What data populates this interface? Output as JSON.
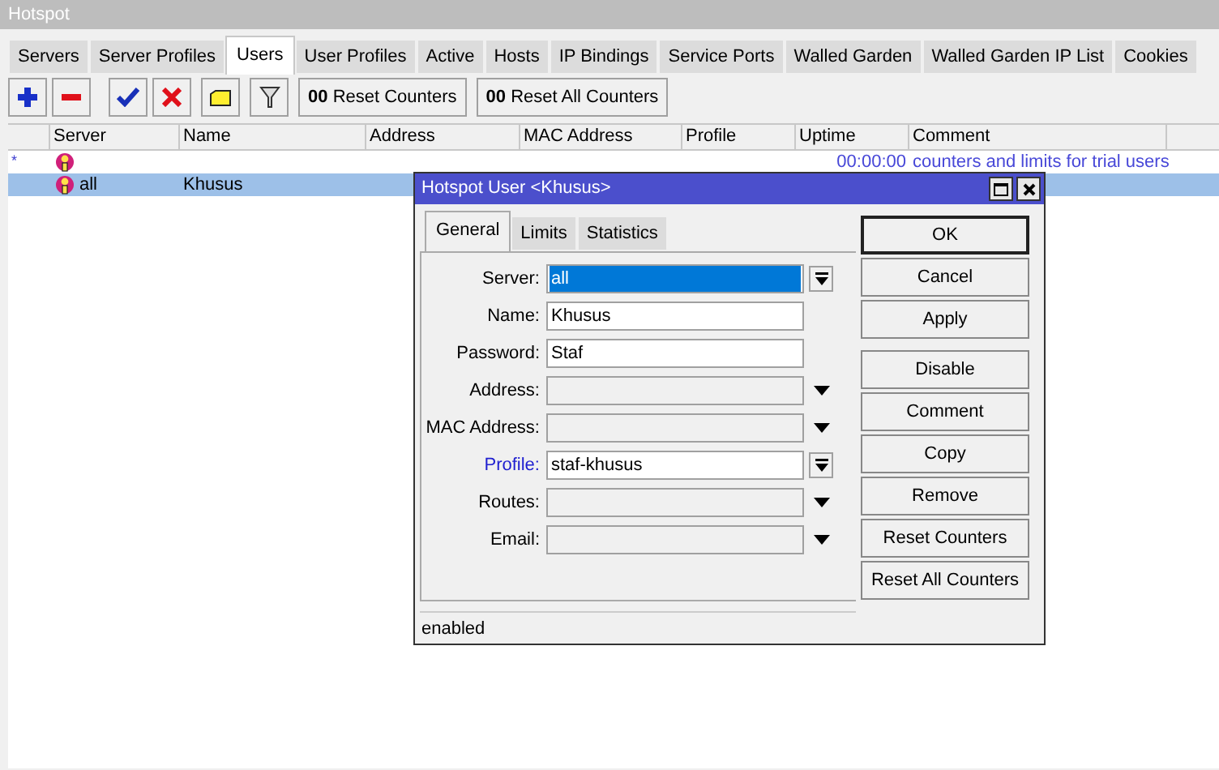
{
  "window": {
    "title": "Hotspot"
  },
  "tabs": [
    {
      "label": "Servers",
      "selected": false
    },
    {
      "label": "Server Profiles",
      "selected": false
    },
    {
      "label": "Users",
      "selected": true
    },
    {
      "label": "User Profiles",
      "selected": false
    },
    {
      "label": "Active",
      "selected": false
    },
    {
      "label": "Hosts",
      "selected": false
    },
    {
      "label": "IP Bindings",
      "selected": false
    },
    {
      "label": "Service Ports",
      "selected": false
    },
    {
      "label": "Walled Garden",
      "selected": false
    },
    {
      "label": "Walled Garden IP List",
      "selected": false
    },
    {
      "label": "Cookies",
      "selected": false
    }
  ],
  "toolbar": {
    "counter_buttons": [
      {
        "prefix": "00",
        "label": "Reset Counters"
      },
      {
        "prefix": "00",
        "label": "Reset All Counters"
      }
    ]
  },
  "table": {
    "columns": [
      "Server",
      "Name",
      "Address",
      "MAC Address",
      "Profile",
      "Uptime",
      "Comment"
    ],
    "rows": [
      {
        "marker": "*",
        "server": "",
        "name": "",
        "uptime": "00:00:00",
        "comment": "counters and limits for trial users",
        "selected": false
      },
      {
        "marker": "",
        "server": "all",
        "name": "Khusus",
        "uptime": "",
        "comment": "",
        "selected": true
      }
    ]
  },
  "dialog": {
    "title": "Hotspot User <Khusus>",
    "tabs": [
      {
        "label": "General",
        "selected": true
      },
      {
        "label": "Limits",
        "selected": false
      },
      {
        "label": "Statistics",
        "selected": false
      }
    ],
    "fields": [
      {
        "label": "Server:",
        "kind": "select",
        "value": "all",
        "highlighted": true,
        "link": false
      },
      {
        "label": "Name:",
        "kind": "text",
        "value": "Khusus",
        "highlighted": false,
        "link": false
      },
      {
        "label": "Password:",
        "kind": "text",
        "value": "Staf",
        "highlighted": false,
        "link": false
      },
      {
        "label": "Address:",
        "kind": "dropdown",
        "link": false
      },
      {
        "label": "MAC Address:",
        "kind": "dropdown",
        "link": false
      },
      {
        "label": "Profile:",
        "kind": "select",
        "value": "staf-khusus",
        "highlighted": false,
        "link": true
      },
      {
        "label": "Routes:",
        "kind": "dropdown",
        "link": false
      },
      {
        "label": "Email:",
        "kind": "dropdown",
        "link": false
      }
    ],
    "buttons": [
      {
        "label": "OK",
        "default": true
      },
      {
        "label": "Cancel",
        "default": false
      },
      {
        "label": "Apply",
        "default": false
      },
      {
        "label": "Disable",
        "default": false
      },
      {
        "label": "Comment",
        "default": false
      },
      {
        "label": "Copy",
        "default": false
      },
      {
        "label": "Remove",
        "default": false
      },
      {
        "label": "Reset Counters",
        "default": false
      },
      {
        "label": "Reset All Counters",
        "default": false
      }
    ],
    "status": "enabled"
  }
}
